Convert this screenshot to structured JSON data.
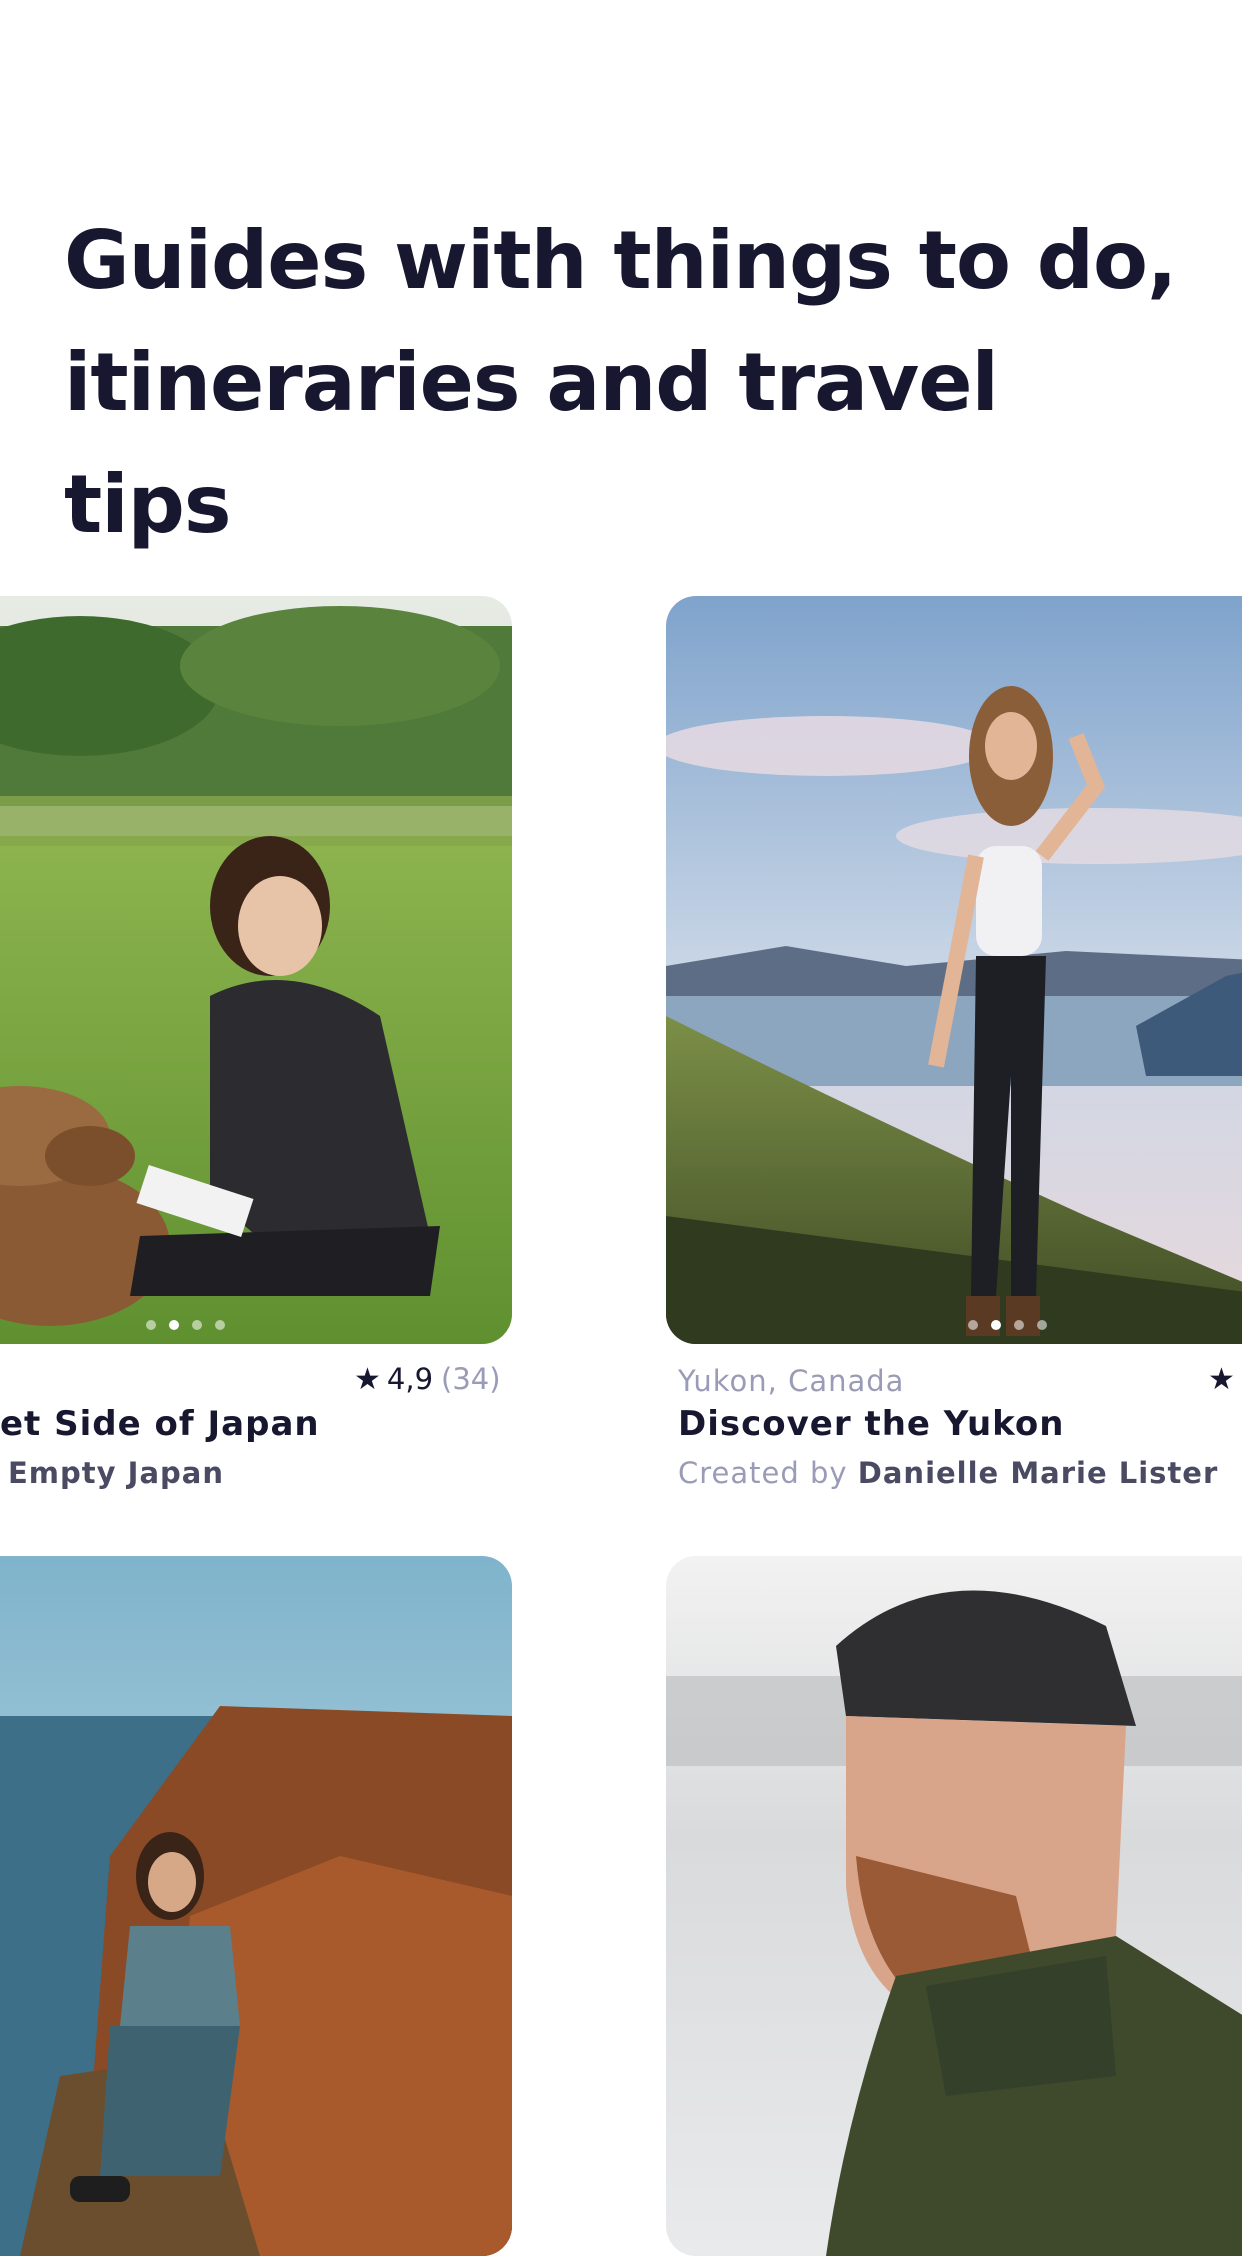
{
  "headline": {
    "line1": "Guides with things to do,",
    "line2": "itineraries and travel tips"
  },
  "cards": [
    {
      "rating_value": "4,9",
      "rating_count": "(34)",
      "title": "et Side of Japan",
      "creator_name": "Empty Japan",
      "slides_total": 4,
      "slide_active": 2
    },
    {
      "location": "Yukon, Canada",
      "title": "Discover the Yukon",
      "creator_prefix": "Created by",
      "creator_name": "Danielle Marie Lister",
      "slides_total": 4,
      "slide_active": 2
    }
  ],
  "icons": {
    "star": "star-icon"
  },
  "colors": {
    "text": "#181730",
    "muted": "#9a9bb6",
    "creator": "#4a4a63"
  }
}
